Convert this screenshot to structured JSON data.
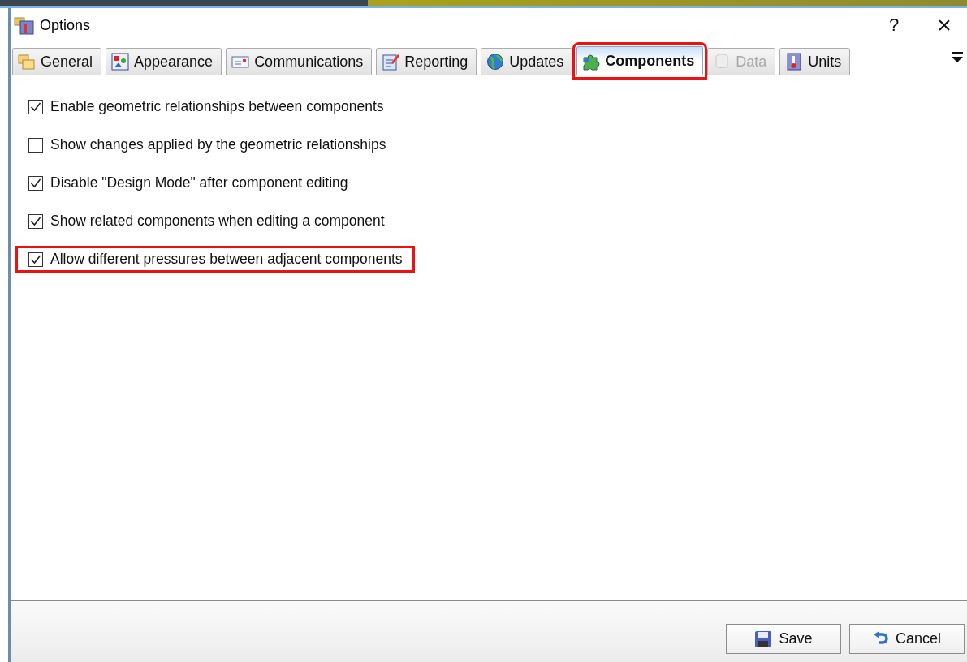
{
  "window": {
    "title": "Options",
    "help": "?",
    "close": "×"
  },
  "tabs": [
    {
      "label": "General",
      "selected": false,
      "disabled": false,
      "highlighted": false
    },
    {
      "label": "Appearance",
      "selected": false,
      "disabled": false,
      "highlighted": false
    },
    {
      "label": "Communications",
      "selected": false,
      "disabled": false,
      "highlighted": false
    },
    {
      "label": "Reporting",
      "selected": false,
      "disabled": false,
      "highlighted": false
    },
    {
      "label": "Updates",
      "selected": false,
      "disabled": false,
      "highlighted": false
    },
    {
      "label": "Components",
      "selected": true,
      "disabled": false,
      "highlighted": true
    },
    {
      "label": "Data",
      "selected": false,
      "disabled": true,
      "highlighted": false
    },
    {
      "label": "Units",
      "selected": false,
      "disabled": false,
      "highlighted": false
    }
  ],
  "options": [
    {
      "label": "Enable geometric relationships between components",
      "checked": true,
      "highlighted": false
    },
    {
      "label": "Show changes applied by the geometric relationships",
      "checked": false,
      "highlighted": false
    },
    {
      "label": "Disable \"Design Mode\" after component editing",
      "checked": true,
      "highlighted": false
    },
    {
      "label": "Show related components when editing a component",
      "checked": true,
      "highlighted": false
    },
    {
      "label": "Allow different pressures between adjacent components",
      "checked": true,
      "highlighted": true
    }
  ],
  "buttons": [
    {
      "label": "Save",
      "kind": "save"
    },
    {
      "label": "Cancel",
      "kind": "cancel"
    }
  ]
}
